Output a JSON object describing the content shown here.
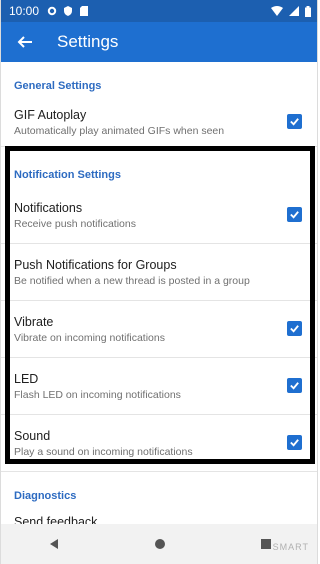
{
  "status_bar": {
    "time": "10:00",
    "icons": [
      "settings-icon",
      "shield-icon",
      "sd-card-icon",
      "wifi-icon",
      "signal-icon",
      "battery-icon"
    ]
  },
  "app_bar": {
    "title": "Settings",
    "back_icon": "arrow-left-icon",
    "color": "#1e6fd0"
  },
  "sections": {
    "general": {
      "header": "General Settings",
      "gif_autoplay": {
        "title": "GIF Autoplay",
        "summary": "Automatically play animated GIFs when seen",
        "checked": true
      }
    },
    "notification": {
      "header": "Notification Settings",
      "notifications": {
        "title": "Notifications",
        "summary": "Receive push notifications",
        "checked": true
      },
      "push_groups": {
        "title": "Push Notifications for Groups",
        "summary": "Be notified when a new thread is posted in a group"
      },
      "vibrate": {
        "title": "Vibrate",
        "summary": "Vibrate on incoming notifications",
        "checked": true
      },
      "led": {
        "title": "LED",
        "summary": "Flash LED on incoming notifications",
        "checked": true
      },
      "sound": {
        "title": "Sound",
        "summary": "Play a sound on incoming notifications",
        "checked": true
      }
    },
    "diagnostics": {
      "header": "Diagnostics",
      "send_feedback": {
        "title": "Send feedback"
      }
    }
  },
  "nav_bar": {
    "icons": [
      "back-triangle-icon",
      "home-circle-icon",
      "recents-square-icon"
    ]
  },
  "watermark": "SMART"
}
